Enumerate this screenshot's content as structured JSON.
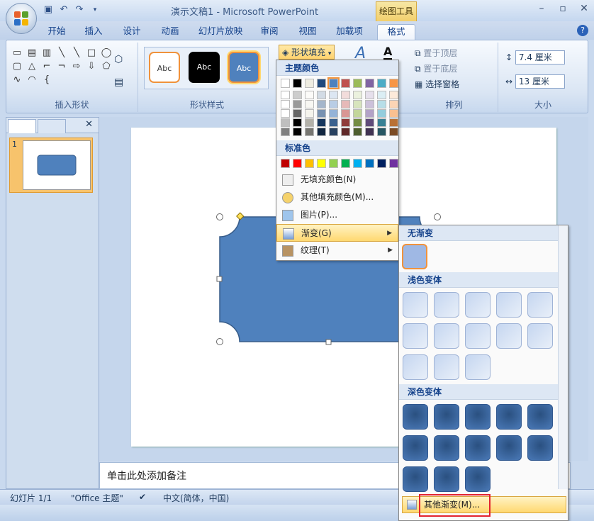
{
  "window": {
    "title": "演示文稿1 - Microsoft PowerPoint",
    "context_tab_title": "绘图工具"
  },
  "tabs": [
    "开始",
    "插入",
    "设计",
    "动画",
    "幻灯片放映",
    "审阅",
    "视图",
    "加载项",
    "格式"
  ],
  "active_tab": "格式",
  "ribbon": {
    "groups": {
      "insert_shapes": "插入形状",
      "shape_styles": "形状样式",
      "arrange": "排列",
      "size": "大小"
    },
    "style_buttons": [
      "Abc",
      "Abc",
      "Abc"
    ],
    "shape_fill_label": "形状填充",
    "arrange_items": [
      "置于顶层",
      "置于底层",
      "选择窗格"
    ],
    "size": {
      "height": "7.4 厘米",
      "width": "13 厘米"
    }
  },
  "left_panel": {
    "slide_number": "1"
  },
  "notes_placeholder": "单击此处添加备注",
  "status_bar": {
    "slide_info": "幻灯片 1/1",
    "theme": "\"Office 主题\"",
    "language": "中文(简体，中国)"
  },
  "fill_menu": {
    "theme_colors_header": "主题颜色",
    "standard_colors_header": "标准色",
    "theme_colors_top": [
      "#ffffff",
      "#000000",
      "#eeece1",
      "#1f497d",
      "#4f81bd",
      "#c0504d",
      "#9bbb59",
      "#8064a2",
      "#4bacc6",
      "#f79646"
    ],
    "standard_colors": [
      "#c00000",
      "#ff0000",
      "#ffc000",
      "#ffff00",
      "#92d050",
      "#00b050",
      "#00b0f0",
      "#0070c0",
      "#002060",
      "#7030a0"
    ],
    "items": [
      {
        "label": "无填充颜色(N)",
        "icon": "no-fill-icon"
      },
      {
        "label": "其他填充颜色(M)...",
        "icon": "palette-icon"
      },
      {
        "label": "图片(P)...",
        "icon": "picture-icon"
      },
      {
        "label": "渐变(G)",
        "icon": "gradient-icon"
      },
      {
        "label": "纹理(T)",
        "icon": "texture-icon"
      }
    ]
  },
  "gradient_menu": {
    "no_gradient_header": "无渐变",
    "light_header": "浅色变体",
    "dark_header": "深色变体",
    "more_label": "其他渐变(M)..."
  },
  "colors": {
    "shape_fill": "#4f81bd",
    "highlight": "#ffd870",
    "annotation_red": "#e2242f"
  }
}
